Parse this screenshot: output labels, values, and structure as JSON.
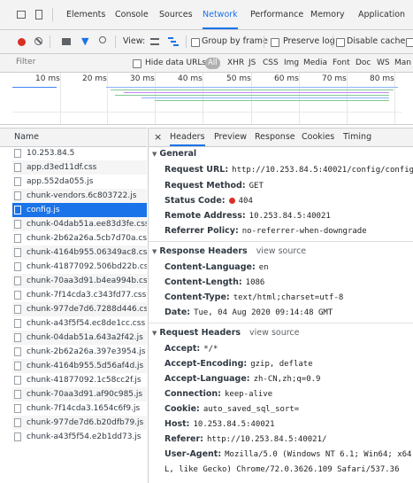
{
  "devtools_tabs": [
    "Elements",
    "Console",
    "Sources",
    "Network",
    "Performance",
    "Memory",
    "Application"
  ],
  "active_tab": "Network",
  "toolbar": {
    "view_label": "View:",
    "group_by_frame": "Group by frame",
    "preserve_log": "Preserve log",
    "disable_cache": "Disable cache"
  },
  "filter": {
    "placeholder": "Filter",
    "hide_data_urls": "Hide data URLs",
    "all": "All",
    "types": [
      "XHR",
      "JS",
      "CSS",
      "Img",
      "Media",
      "Font",
      "Doc",
      "WS",
      "Man"
    ]
  },
  "overview": {
    "ticks": [
      "10 ms",
      "20 ms",
      "30 ms",
      "40 ms",
      "50 ms",
      "60 ms",
      "70 ms",
      "80 ms"
    ]
  },
  "requests": {
    "header": "Name",
    "selected_index": 4,
    "items": [
      "10.253.84.5",
      "app.d3ed11df.css",
      "app.552da055.js",
      "chunk-vendors.6c803722.js",
      "config.js",
      "chunk-04dab51a.ee83d3fe.css",
      "chunk-2b62a26a.5cb7d70a.css",
      "chunk-4164b955.06349ac8.css",
      "chunk-41877092.506bd22b.css",
      "chunk-70aa3d91.b4ea994b.css",
      "chunk-7f14cda3.c343fd77.css",
      "chunk-977de7d6.7288d446.css",
      "chunk-a43f5f54.ec8de1cc.css",
      "chunk-04dab51a.643a2f42.js",
      "chunk-2b62a26a.397e3954.js",
      "chunk-4164b955.5d56af4d.js",
      "chunk-41877092.1c58cc2f.js",
      "chunk-70aa3d91.af90c985.js",
      "chunk-7f14cda3.1654c6f9.js",
      "chunk-977de7d6.b20dfb79.js",
      "chunk-a43f5f54.e2b1dd73.js"
    ]
  },
  "detail": {
    "close": "×",
    "tabs": [
      "Headers",
      "Preview",
      "Response",
      "Cookies",
      "Timing"
    ],
    "active_tab": "Headers",
    "general": {
      "title": "General",
      "request_url_k": "Request URL:",
      "request_url_v": "http://10.253.84.5:40021/config/config.js",
      "method_k": "Request Method:",
      "method_v": "GET",
      "status_k": "Status Code:",
      "status_v": "404",
      "remote_k": "Remote Address:",
      "remote_v": "10.253.84.5:40021",
      "referrer_k": "Referrer Policy:",
      "referrer_v": "no-referrer-when-downgrade"
    },
    "response_headers": {
      "title": "Response Headers",
      "source": "view source",
      "content_language_k": "Content-Language:",
      "content_language_v": "en",
      "content_length_k": "Content-Length:",
      "content_length_v": "1086",
      "content_type_k": "Content-Type:",
      "content_type_v": "text/html;charset=utf-8",
      "date_k": "Date:",
      "date_v": "Tue, 04 Aug 2020 09:14:48 GMT"
    },
    "request_headers": {
      "title": "Request Headers",
      "source": "view source",
      "accept_k": "Accept:",
      "accept_v": "*/*",
      "accept_encoding_k": "Accept-Encoding:",
      "accept_encoding_v": "gzip, deflate",
      "accept_language_k": "Accept-Language:",
      "accept_language_v": "zh-CN,zh;q=0.9",
      "connection_k": "Connection:",
      "connection_v": "keep-alive",
      "cookie_k": "Cookie:",
      "cookie_v": "auto_saved_sql_sort=",
      "host_k": "Host:",
      "host_v": "10.253.84.5:40021",
      "referer_k": "Referer:",
      "referer_v": "http://10.253.84.5:40021/",
      "user_agent_k": "User-Agent:",
      "user_agent_v": "Mozilla/5.0 (Windows NT 6.1; Win64; x64) A",
      "user_agent_v2": "L, like Gecko) Chrome/72.0.3626.109 Safari/537.36"
    }
  },
  "colors": {
    "accent": "#1a73e8",
    "record": "#d93025",
    "error_status": "#d93025"
  }
}
